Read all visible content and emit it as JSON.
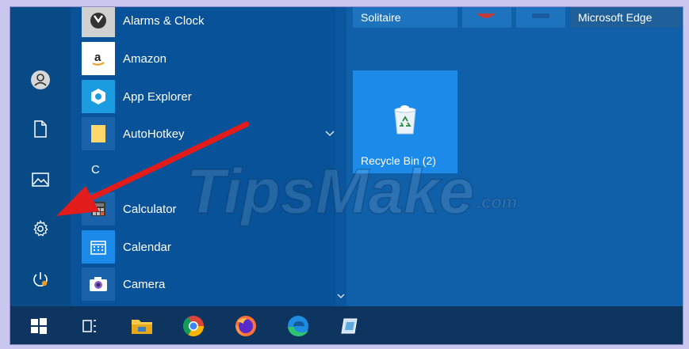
{
  "apps": {
    "alarms": "Alarms & Clock",
    "amazon": "Amazon",
    "app_explorer": "App Explorer",
    "autohotkey": "AutoHotkey",
    "group_c": "C",
    "calculator": "Calculator",
    "calendar": "Calendar",
    "camera": "Camera"
  },
  "tiles": {
    "solitaire": "Solitaire",
    "edge": "Microsoft Edge",
    "recycle_bin": "Recycle Bin (2)"
  },
  "watermark": {
    "brand": "TipsMake",
    "suffix": ".com"
  },
  "icons": {
    "rail": [
      "user-icon",
      "document-icon",
      "pictures-icon",
      "settings-gear-icon",
      "power-icon"
    ],
    "taskbar": [
      "windows-start-icon",
      "task-view-icon",
      "file-explorer-icon",
      "chrome-icon",
      "firefox-icon",
      "edge-icon",
      "app-icon"
    ]
  },
  "colors": {
    "accent": "#1b8ae8",
    "rail_bg": "#074a86",
    "taskbar_bg": "#0d3560",
    "arrow": "#e21b1b"
  }
}
